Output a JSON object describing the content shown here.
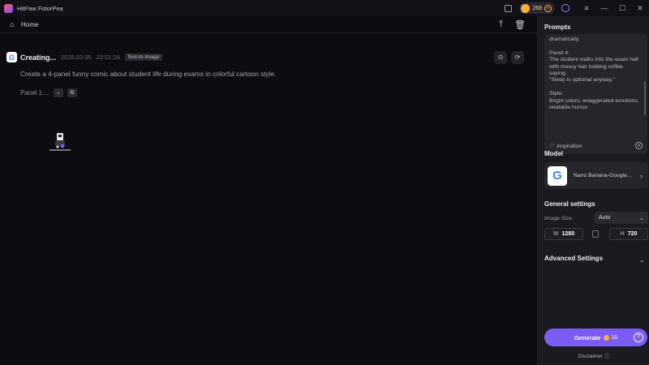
{
  "app": {
    "title": "HitPaw FotorPea",
    "credits": "268"
  },
  "nav": {
    "home_label": "Home"
  },
  "task": {
    "status": "Creating...",
    "date": "2026.03.05",
    "time": "22:01:28",
    "tag": "Text-to-Image",
    "prompt": "Create a 4-panel funny comic about student life during exams in colorful cartoon style.",
    "panel_label": "Panel 1:..."
  },
  "sidebar": {
    "prompts_heading": "Prompts",
    "prompt_lines": [
      "dramatically.",
      "",
      "Panel 4:",
      "The student walks into the exam hall",
      "with messy hair holding coffee",
      "saying:",
      "\"Sleep is optional anyway.\"",
      "",
      "Style:",
      "Bright colors, exaggerated emotions,",
      "relatable humor."
    ],
    "inspiration_label": "inspiration",
    "model_heading": "Model",
    "model_name": "Nano Banana-Google...",
    "general_heading": "General settings",
    "image_size_label": "Image Size",
    "image_size_value": "Auto",
    "width_key": "W",
    "width_value": "1280",
    "height_key": "H",
    "height_value": "720",
    "advanced_heading": "Advanced Settings",
    "generate_label": "Generate",
    "generate_cost": "16",
    "disclaimer": "Disclaimer"
  },
  "colors": {
    "accent": "#7b5cf5",
    "coin": "#f2b33d",
    "background": "#0d0c11",
    "panel": "#1b1a20"
  }
}
